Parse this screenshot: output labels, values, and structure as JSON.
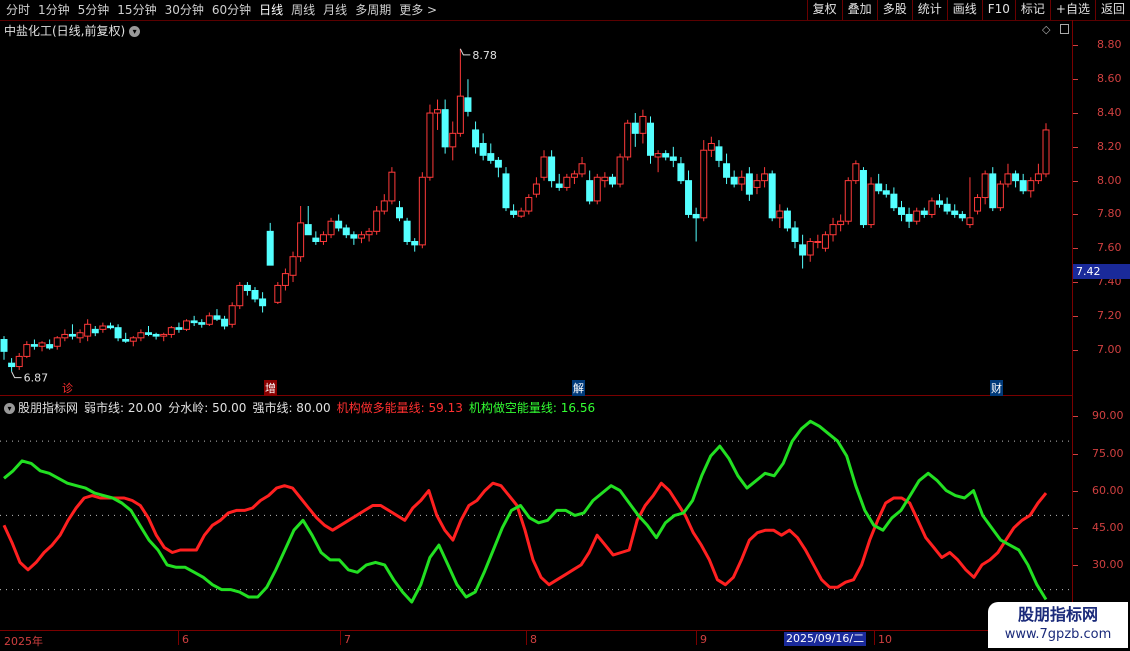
{
  "periods": [
    "分时",
    "1分钟",
    "5分钟",
    "15分钟",
    "30分钟",
    "60分钟",
    "日线",
    "周线",
    "月线",
    "多周期",
    "更多 >"
  ],
  "active_period": "日线",
  "toolbar": [
    "复权",
    "叠加",
    "多股",
    "统计",
    "画线",
    "F10",
    "标记",
    "+自选",
    "返回"
  ],
  "stock_title": "中盐化工(日线,前复权)",
  "price_axis": [
    "8.80",
    "8.60",
    "8.40",
    "8.20",
    "8.00",
    "7.80",
    "7.60",
    "7.40",
    "7.20",
    "7.00"
  ],
  "current_price": "7.42",
  "high_label": "8.78",
  "low_label": "6.87",
  "events": [
    "诊",
    "增",
    "解",
    "财"
  ],
  "indicator": {
    "name": "股朋指标网",
    "weak": "弱市线: 20.00",
    "mid": "分水岭: 50.00",
    "strong": "强市线: 80.00",
    "bull": "机构做多能量线: 59.13",
    "bear": "机构做空能量线: 16.56"
  },
  "indicator_axis": [
    "90.00",
    "75.00",
    "60.00",
    "45.00",
    "30.00"
  ],
  "x_axis": [
    "2025年",
    "6",
    "7",
    "8",
    "9",
    "10"
  ],
  "cursor_date": "2025/09/16/二",
  "watermark": {
    "title": "股朋指标网",
    "url": "www.7gpzb.com"
  },
  "colors": {
    "up": "#ff3a3a",
    "down": "#54ffff",
    "bull": "#ff2020",
    "bear": "#22e022",
    "axis": "#7a0000"
  },
  "chart_data": [
    {
      "type": "candlestick",
      "title": "中盐化工(日线,前复权)",
      "ylim": [
        6.85,
        8.85
      ],
      "ohlc": [
        [
          7.06,
          7.08,
          6.94,
          6.99
        ],
        [
          6.92,
          6.95,
          6.87,
          6.9
        ],
        [
          6.9,
          6.98,
          6.88,
          6.96
        ],
        [
          6.96,
          7.05,
          6.95,
          7.03
        ],
        [
          7.03,
          7.06,
          7.0,
          7.02
        ],
        [
          7.02,
          7.05,
          6.99,
          7.04
        ],
        [
          7.03,
          7.06,
          7.0,
          7.01
        ],
        [
          7.02,
          7.08,
          7.0,
          7.07
        ],
        [
          7.07,
          7.12,
          7.05,
          7.09
        ],
        [
          7.09,
          7.15,
          7.06,
          7.08
        ],
        [
          7.07,
          7.12,
          7.04,
          7.1
        ],
        [
          7.08,
          7.18,
          7.05,
          7.15
        ],
        [
          7.12,
          7.14,
          7.08,
          7.1
        ],
        [
          7.12,
          7.16,
          7.1,
          7.14
        ],
        [
          7.14,
          7.16,
          7.12,
          7.13
        ],
        [
          7.13,
          7.15,
          7.05,
          7.07
        ],
        [
          7.06,
          7.1,
          7.04,
          7.05
        ],
        [
          7.05,
          7.08,
          7.02,
          7.07
        ],
        [
          7.07,
          7.12,
          7.05,
          7.1
        ],
        [
          7.1,
          7.14,
          7.08,
          7.09
        ],
        [
          7.09,
          7.1,
          7.06,
          7.08
        ],
        [
          7.08,
          7.1,
          7.05,
          7.09
        ],
        [
          7.09,
          7.14,
          7.07,
          7.13
        ],
        [
          7.13,
          7.16,
          7.1,
          7.12
        ],
        [
          7.12,
          7.18,
          7.11,
          7.17
        ],
        [
          7.17,
          7.2,
          7.14,
          7.16
        ],
        [
          7.16,
          7.18,
          7.13,
          7.15
        ],
        [
          7.15,
          7.22,
          7.14,
          7.2
        ],
        [
          7.2,
          7.24,
          7.17,
          7.18
        ],
        [
          7.18,
          7.2,
          7.12,
          7.14
        ],
        [
          7.15,
          7.28,
          7.13,
          7.26
        ],
        [
          7.26,
          7.4,
          7.24,
          7.38
        ],
        [
          7.38,
          7.4,
          7.32,
          7.35
        ],
        [
          7.35,
          7.37,
          7.28,
          7.3
        ],
        [
          7.3,
          7.34,
          7.22,
          7.26
        ],
        [
          7.7,
          7.75,
          7.52,
          7.5
        ],
        [
          7.28,
          7.4,
          7.27,
          7.38
        ],
        [
          7.38,
          7.48,
          7.35,
          7.45
        ],
        [
          7.44,
          7.58,
          7.4,
          7.55
        ],
        [
          7.55,
          7.85,
          7.52,
          7.75
        ],
        [
          7.74,
          7.85,
          7.68,
          7.68
        ],
        [
          7.66,
          7.7,
          7.62,
          7.64
        ],
        [
          7.64,
          7.7,
          7.62,
          7.68
        ],
        [
          7.68,
          7.78,
          7.66,
          7.76
        ],
        [
          7.76,
          7.8,
          7.7,
          7.72
        ],
        [
          7.72,
          7.74,
          7.66,
          7.68
        ],
        [
          7.68,
          7.7,
          7.62,
          7.66
        ],
        [
          7.66,
          7.7,
          7.63,
          7.68
        ],
        [
          7.68,
          7.72,
          7.64,
          7.7
        ],
        [
          7.7,
          7.85,
          7.68,
          7.82
        ],
        [
          7.82,
          7.92,
          7.8,
          7.88
        ],
        [
          7.88,
          8.08,
          7.86,
          8.05
        ],
        [
          7.84,
          7.88,
          7.76,
          7.78
        ],
        [
          7.76,
          7.78,
          7.62,
          7.64
        ],
        [
          7.64,
          7.66,
          7.58,
          7.62
        ],
        [
          7.62,
          8.05,
          7.6,
          8.02
        ],
        [
          8.02,
          8.45,
          8.0,
          8.4
        ],
        [
          8.4,
          8.48,
          8.3,
          8.42
        ],
        [
          8.42,
          8.48,
          8.16,
          8.2
        ],
        [
          8.2,
          8.35,
          8.12,
          8.28
        ],
        [
          8.28,
          8.78,
          8.26,
          8.5
        ],
        [
          8.49,
          8.6,
          8.38,
          8.41
        ],
        [
          8.3,
          8.35,
          8.16,
          8.2
        ],
        [
          8.22,
          8.28,
          8.12,
          8.15
        ],
        [
          8.16,
          8.22,
          8.1,
          8.12
        ],
        [
          8.12,
          8.14,
          8.02,
          8.08
        ],
        [
          8.04,
          8.08,
          7.82,
          7.84
        ],
        [
          7.82,
          7.86,
          7.78,
          7.8
        ],
        [
          7.79,
          7.84,
          7.78,
          7.82
        ],
        [
          7.82,
          7.92,
          7.8,
          7.9
        ],
        [
          7.92,
          8.02,
          7.9,
          7.98
        ],
        [
          8.02,
          8.18,
          8.0,
          8.14
        ],
        [
          8.14,
          8.18,
          7.96,
          8.0
        ],
        [
          7.98,
          8.04,
          7.94,
          7.96
        ],
        [
          7.96,
          8.04,
          7.94,
          8.02
        ],
        [
          8.02,
          8.06,
          7.98,
          8.04
        ],
        [
          8.04,
          8.14,
          8.02,
          8.1
        ],
        [
          8.0,
          8.06,
          7.86,
          7.88
        ],
        [
          7.88,
          8.04,
          7.86,
          8.02
        ],
        [
          8.0,
          8.05,
          7.96,
          8.02
        ],
        [
          8.02,
          8.04,
          7.96,
          7.98
        ],
        [
          7.98,
          8.16,
          7.96,
          8.14
        ],
        [
          8.14,
          8.36,
          8.12,
          8.34
        ],
        [
          8.34,
          8.4,
          8.2,
          8.28
        ],
        [
          8.28,
          8.42,
          8.22,
          8.38
        ],
        [
          8.34,
          8.38,
          8.1,
          8.15
        ],
        [
          8.14,
          8.18,
          8.05,
          8.16
        ],
        [
          8.16,
          8.18,
          8.12,
          8.14
        ],
        [
          8.14,
          8.2,
          8.08,
          8.12
        ],
        [
          8.1,
          8.14,
          7.98,
          8.0
        ],
        [
          8.0,
          8.06,
          7.78,
          7.8
        ],
        [
          7.8,
          7.84,
          7.64,
          7.78
        ],
        [
          7.78,
          8.24,
          7.76,
          8.18
        ],
        [
          8.18,
          8.26,
          8.14,
          8.22
        ],
        [
          8.2,
          8.24,
          8.08,
          8.12
        ],
        [
          8.1,
          8.16,
          7.98,
          8.02
        ],
        [
          8.02,
          8.06,
          7.96,
          7.98
        ],
        [
          7.98,
          8.06,
          7.94,
          8.02
        ],
        [
          8.04,
          8.08,
          7.88,
          7.92
        ],
        [
          7.96,
          8.04,
          7.92,
          8.0
        ],
        [
          8.0,
          8.08,
          7.96,
          8.04
        ],
        [
          8.04,
          8.06,
          7.76,
          7.78
        ],
        [
          7.78,
          7.86,
          7.72,
          7.82
        ],
        [
          7.82,
          7.84,
          7.7,
          7.72
        ],
        [
          7.72,
          7.76,
          7.6,
          7.64
        ],
        [
          7.62,
          7.68,
          7.48,
          7.56
        ],
        [
          7.56,
          7.66,
          7.52,
          7.64
        ],
        [
          7.64,
          7.68,
          7.6,
          7.64
        ],
        [
          7.6,
          7.7,
          7.58,
          7.68
        ],
        [
          7.68,
          7.78,
          7.64,
          7.74
        ],
        [
          7.74,
          7.8,
          7.7,
          7.76
        ],
        [
          7.76,
          8.02,
          7.74,
          8.0
        ],
        [
          8.0,
          8.12,
          7.98,
          8.1
        ],
        [
          8.06,
          8.08,
          7.72,
          7.74
        ],
        [
          7.74,
          8.02,
          7.72,
          7.98
        ],
        [
          7.98,
          8.04,
          7.92,
          7.94
        ],
        [
          7.94,
          7.98,
          7.9,
          7.92
        ],
        [
          7.92,
          7.96,
          7.82,
          7.84
        ],
        [
          7.84,
          7.88,
          7.76,
          7.8
        ],
        [
          7.8,
          7.84,
          7.72,
          7.76
        ],
        [
          7.76,
          7.84,
          7.74,
          7.82
        ],
        [
          7.82,
          7.84,
          7.78,
          7.8
        ],
        [
          7.8,
          7.9,
          7.78,
          7.88
        ],
        [
          7.88,
          7.92,
          7.84,
          7.86
        ],
        [
          7.86,
          7.9,
          7.8,
          7.82
        ],
        [
          7.82,
          7.86,
          7.78,
          7.8
        ],
        [
          7.8,
          7.82,
          7.76,
          7.78
        ],
        [
          7.74,
          8.02,
          7.72,
          7.78
        ],
        [
          7.82,
          7.92,
          7.8,
          7.9
        ],
        [
          7.9,
          8.06,
          7.86,
          8.04
        ],
        [
          8.04,
          8.08,
          7.82,
          7.84
        ],
        [
          7.84,
          8.0,
          7.82,
          7.98
        ],
        [
          7.98,
          8.1,
          7.96,
          8.04
        ],
        [
          8.04,
          8.06,
          7.96,
          8.0
        ],
        [
          8.0,
          8.04,
          7.92,
          7.94
        ],
        [
          7.94,
          8.02,
          7.9,
          8.0
        ],
        [
          8.0,
          8.1,
          7.98,
          8.04
        ],
        [
          8.04,
          8.34,
          8.02,
          8.3
        ]
      ]
    },
    {
      "type": "line",
      "ylim": [
        15,
        95
      ],
      "reference_lines": [
        20,
        50,
        80
      ],
      "series": [
        {
          "name": "机构做多能量线",
          "color": "#ff2020",
          "values": [
            46,
            39,
            31,
            28,
            31,
            35,
            38,
            42,
            48,
            53,
            57,
            58,
            57,
            57,
            57,
            57,
            56,
            54,
            49,
            42,
            37,
            35,
            36,
            36,
            36,
            42,
            46,
            48,
            51,
            52,
            52,
            53,
            56,
            58,
            61,
            62,
            61,
            57,
            53,
            49,
            46,
            44,
            46,
            48,
            50,
            52,
            54,
            54,
            52,
            50,
            48,
            53,
            56,
            60,
            50,
            44,
            40,
            48,
            54,
            56,
            60,
            63,
            62,
            58,
            54,
            44,
            32,
            25,
            22,
            24,
            26,
            28,
            30,
            35,
            42,
            38,
            34,
            35,
            36,
            48,
            54,
            58,
            63,
            60,
            55,
            50,
            43,
            38,
            32,
            24,
            22,
            25,
            32,
            40,
            43,
            44,
            44,
            42,
            44,
            41,
            36,
            30,
            24,
            21,
            21,
            23,
            24,
            30,
            40,
            48,
            55,
            57,
            57,
            55,
            48,
            41,
            37,
            33,
            35,
            32,
            28,
            25,
            30,
            32,
            35,
            40,
            45,
            48,
            50,
            55,
            59
          ]
        },
        {
          "name": "机构做空能量线",
          "color": "#22e022",
          "values": [
            65,
            68,
            72,
            71,
            68,
            67,
            65,
            63,
            62,
            61,
            59,
            58,
            57,
            55,
            52,
            46,
            40,
            36,
            30,
            29,
            29,
            27,
            25,
            22,
            20,
            20,
            19,
            17,
            17,
            21,
            28,
            36,
            44,
            48,
            42,
            35,
            32,
            32,
            28,
            27,
            30,
            31,
            30,
            24,
            19,
            15,
            22,
            33,
            38,
            30,
            22,
            17,
            19,
            27,
            36,
            45,
            52,
            54,
            49,
            47,
            48,
            52,
            52,
            50,
            51,
            56,
            59,
            62,
            60,
            55,
            50,
            46,
            41,
            47,
            50,
            51,
            56,
            66,
            74,
            78,
            73,
            66,
            61,
            64,
            67,
            66,
            71,
            80,
            85,
            88,
            86,
            83,
            80,
            74,
            62,
            52,
            46,
            44,
            49,
            52,
            58,
            64,
            67,
            64,
            60,
            58,
            57,
            60,
            50,
            45,
            40,
            38,
            36,
            30,
            22,
            16
          ]
        }
      ]
    }
  ]
}
